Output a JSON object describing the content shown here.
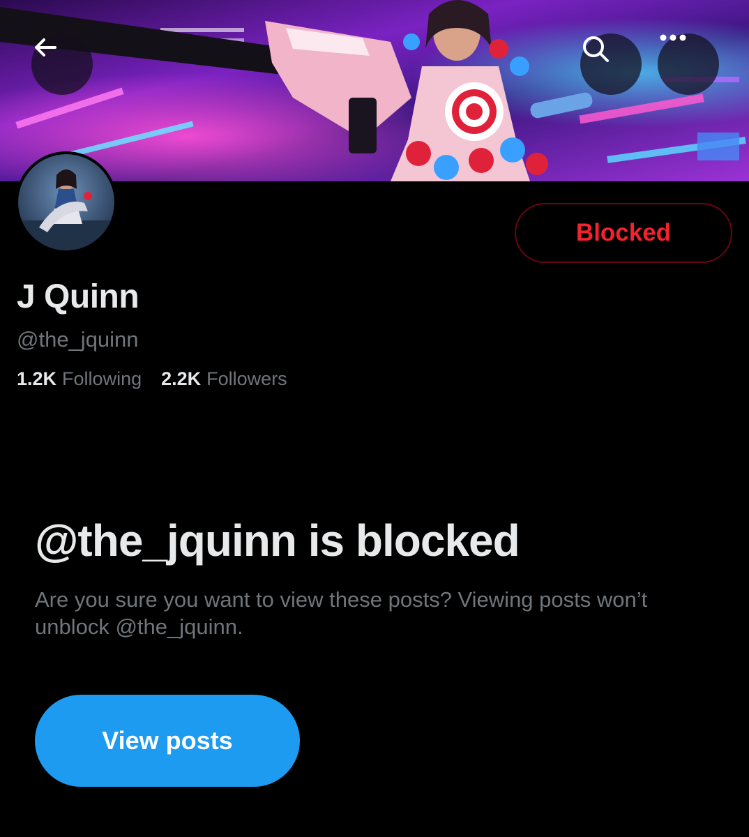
{
  "header": {
    "back_icon": "arrow-left-icon",
    "search_icon": "search-icon",
    "more_icon": "more-horizontal-icon",
    "more_glyph": "•••"
  },
  "profile": {
    "display_name": "J Quinn",
    "handle": "@the_jquinn",
    "following_count": "1.2K",
    "following_label": "Following",
    "followers_count": "2.2K",
    "followers_label": "Followers",
    "blocked_label": "Blocked"
  },
  "blocked_notice": {
    "title": "@the_jquinn is blocked",
    "message": "Are you sure you want to view these posts? Viewing posts won’t unblock @the_jquinn.",
    "view_posts_label": "View posts"
  },
  "colors": {
    "background": "#000000",
    "primary_text": "#e7e9ea",
    "secondary_text": "#71767b",
    "blocked_red": "#f4212e",
    "blocked_border": "#67070f",
    "accent_blue": "#1d9bf0"
  }
}
